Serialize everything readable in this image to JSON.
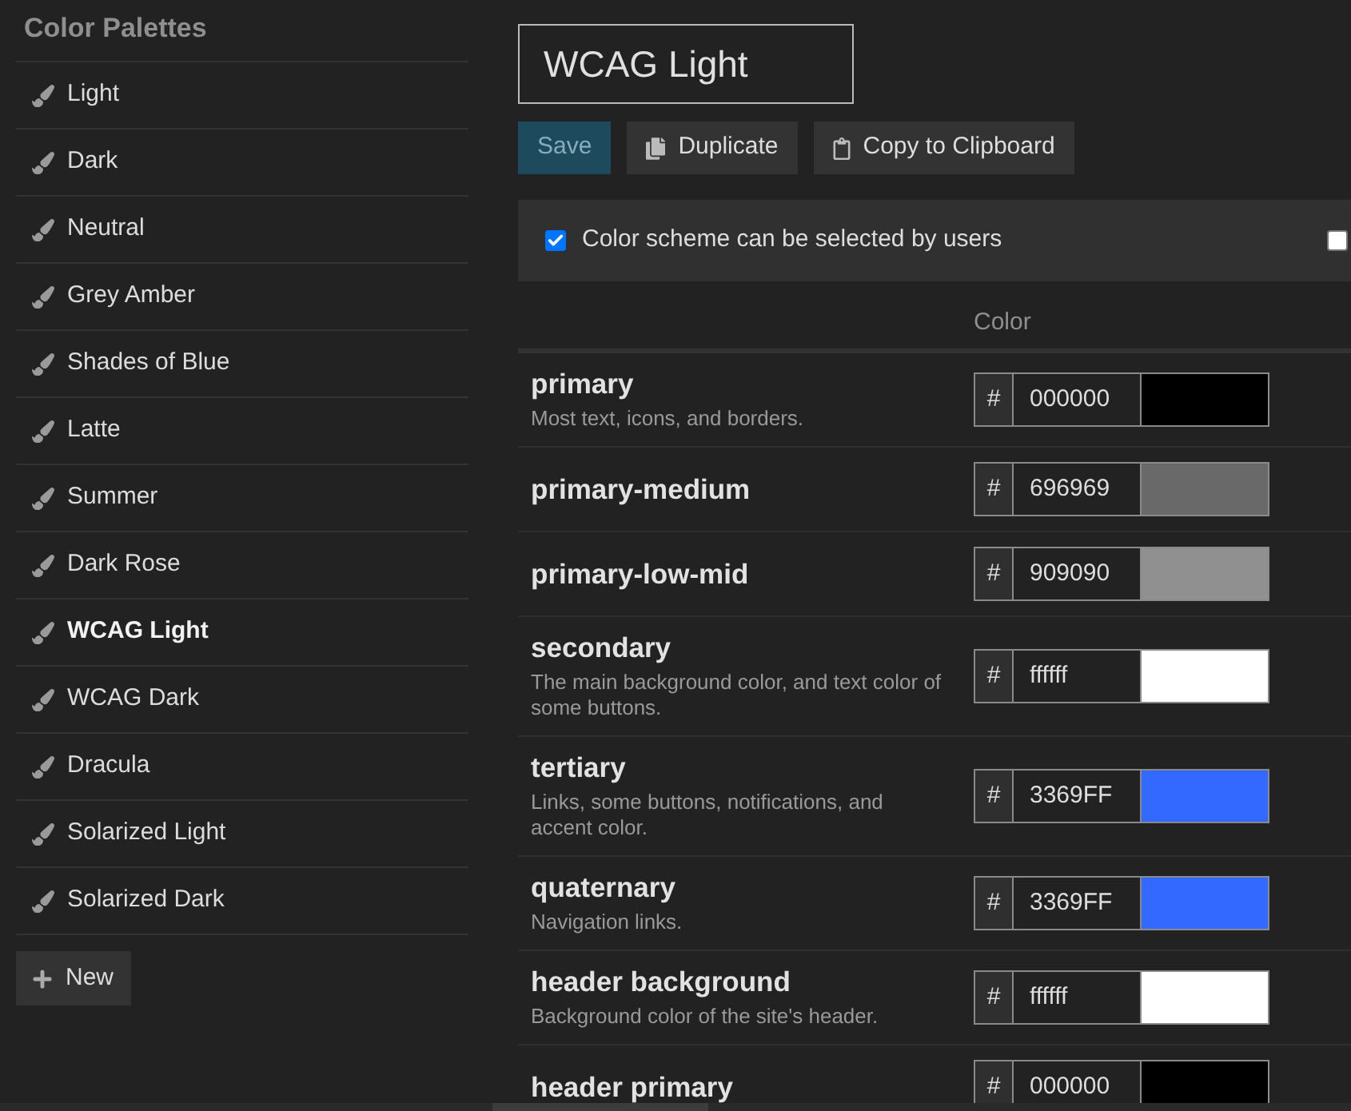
{
  "sidebar": {
    "title": "Color Palettes",
    "items": [
      {
        "label": "Light",
        "selected": false
      },
      {
        "label": "Dark",
        "selected": false
      },
      {
        "label": "Neutral",
        "selected": false
      },
      {
        "label": "Grey Amber",
        "selected": false
      },
      {
        "label": "Shades of Blue",
        "selected": false
      },
      {
        "label": "Latte",
        "selected": false
      },
      {
        "label": "Summer",
        "selected": false
      },
      {
        "label": "Dark Rose",
        "selected": false
      },
      {
        "label": "WCAG Light",
        "selected": true
      },
      {
        "label": "WCAG Dark",
        "selected": false
      },
      {
        "label": "Dracula",
        "selected": false
      },
      {
        "label": "Solarized Light",
        "selected": false
      },
      {
        "label": "Solarized Dark",
        "selected": false
      }
    ],
    "new_button": {
      "label": "New"
    }
  },
  "editor": {
    "name_value": "WCAG Light",
    "buttons": [
      {
        "label": "Save",
        "kind": "primary",
        "disabled": true
      },
      {
        "label": "Duplicate",
        "kind": "duplicate",
        "disabled": false
      },
      {
        "label": "Copy to Clipboard",
        "kind": "clipboard",
        "disabled": false
      }
    ],
    "options": [
      {
        "label": "Color scheme can be selected by users",
        "checked": true
      },
      {
        "checked": false
      }
    ],
    "table": {
      "columns": [
        "Color"
      ],
      "rows": [
        {
          "name": "primary",
          "description": "Most text, icons, and borders.",
          "prefix": "#",
          "value": "000000",
          "color": "#000000"
        },
        {
          "name": "primary-medium",
          "prefix": "#",
          "value": "696969",
          "color": "#696969"
        },
        {
          "name": "primary-low-mid",
          "prefix": "#",
          "value": "909090",
          "color": "#909090"
        },
        {
          "name": "secondary",
          "description": "The main background color, and text color of some buttons.",
          "prefix": "#",
          "value": "ffffff",
          "color": "#ffffff"
        },
        {
          "name": "tertiary",
          "description": "Links, some buttons, notifications, and accent color.",
          "prefix": "#",
          "value": "3369FF",
          "color": "#3369ff"
        },
        {
          "name": "quaternary",
          "description": "Navigation links.",
          "prefix": "#",
          "value": "3369FF",
          "color": "#3369ff"
        },
        {
          "name": "header background",
          "description": "Background color of the site's header.",
          "prefix": "#",
          "value": "ffffff",
          "color": "#ffffff"
        },
        {
          "name": "header primary",
          "prefix": "#",
          "value": "000000",
          "color": "#000000"
        }
      ]
    }
  }
}
